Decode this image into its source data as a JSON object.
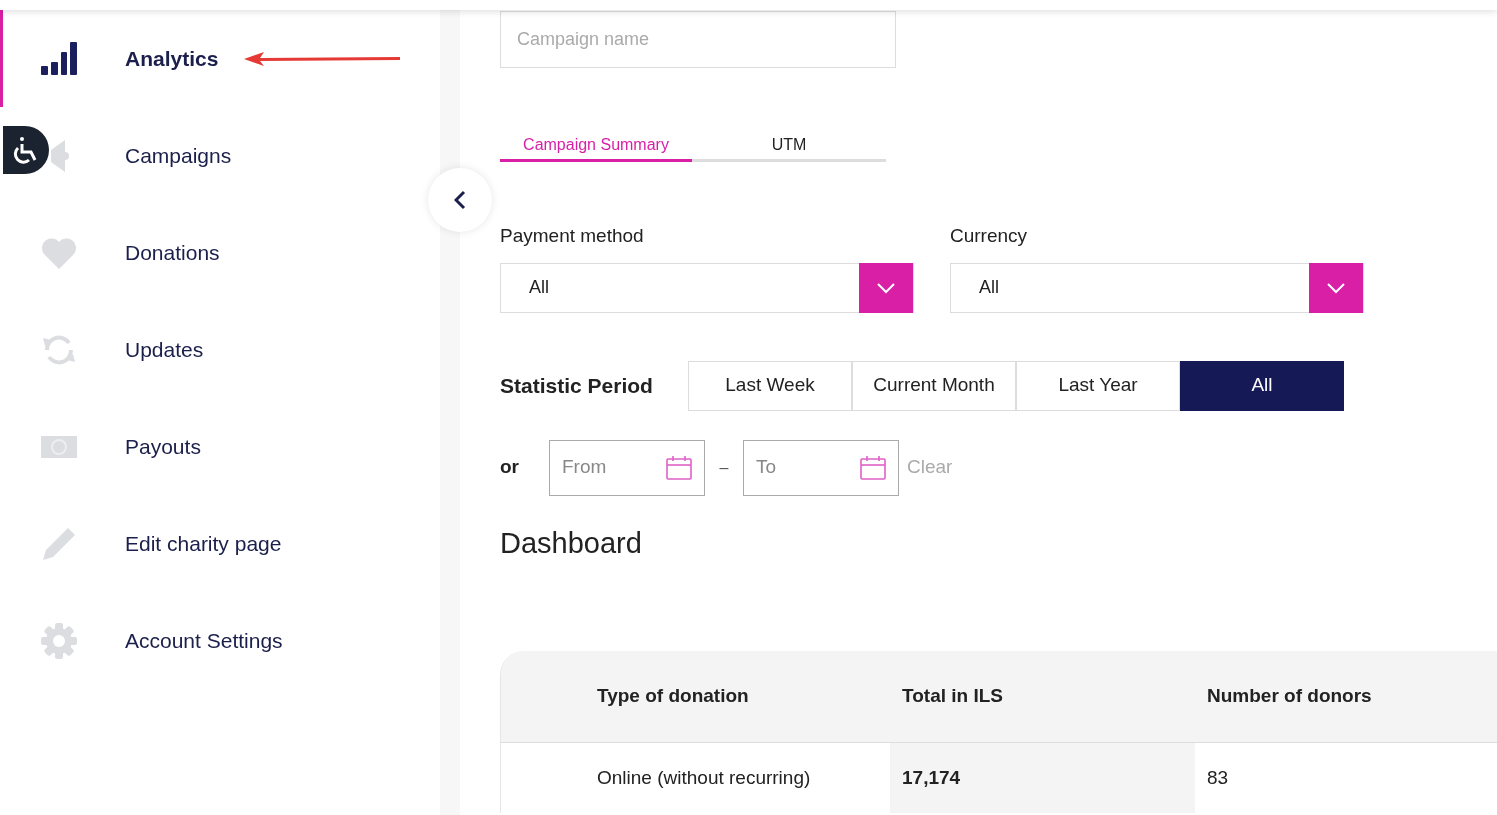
{
  "sidebar": {
    "items": [
      {
        "label": "Analytics",
        "selected": true
      },
      {
        "label": "Campaigns",
        "selected": false
      },
      {
        "label": "Donations",
        "selected": false
      },
      {
        "label": "Updates",
        "selected": false
      },
      {
        "label": "Payouts",
        "selected": false
      },
      {
        "label": "Edit charity page",
        "selected": false
      },
      {
        "label": "Account Settings",
        "selected": false
      }
    ]
  },
  "campaign_search": {
    "placeholder": "Campaign name"
  },
  "tabs": [
    {
      "label": "Campaign Summary",
      "selected": true
    },
    {
      "label": "UTM",
      "selected": false
    }
  ],
  "filters": [
    {
      "label": "Payment method",
      "value": "All"
    },
    {
      "label": "Currency",
      "value": "All"
    }
  ],
  "statistic_period": {
    "label": "Statistic Period",
    "options": [
      {
        "label": "Last Week",
        "selected": false
      },
      {
        "label": "Current Month",
        "selected": false
      },
      {
        "label": "Last Year",
        "selected": false
      },
      {
        "label": "All",
        "selected": true
      }
    ]
  },
  "date_range": {
    "or_label": "or",
    "from": {
      "placeholder": "From"
    },
    "separator": "–",
    "to": {
      "placeholder": "To"
    },
    "clear": "Clear"
  },
  "dashboard": {
    "title": "Dashboard",
    "table": {
      "columns": [
        "Type of donation",
        "Total in ILS",
        "Number of donors"
      ],
      "rows": [
        [
          "Online (without recurring)",
          "17,174",
          "83"
        ]
      ]
    }
  }
}
